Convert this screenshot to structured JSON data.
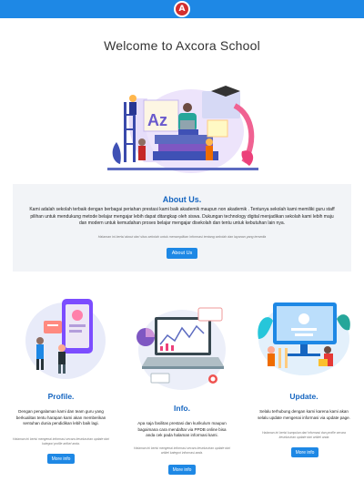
{
  "header": {
    "logo_letter": "A",
    "brand_color": "#1e88e5"
  },
  "hero": {
    "title": "Welcome to Axcora School",
    "illustration_letters": "Az"
  },
  "about": {
    "title": "About Us.",
    "body": "Kami adalah sekolah terbaik dengan berbagai periahan prestasi kami baik akademik maupun non akademik . Tentunya sekolah kami memiliki guru staff pilihan untuk mendukung metode belajar mengajar lebih dapat ditangkap oleh siswa. Dukungan technology digital menjadikan sekolah kami lebih maju dan modern untuk kemudahan proses belajar mengajar disekolah dan tentu untuk kebutuhan lain nya.",
    "note": "Halaman ini berisi about dari situs sekolah untuk menampilkan informasi tentang sekolah dan layanan yang tersedia",
    "button": "About Us"
  },
  "cards": [
    {
      "title": "Profile.",
      "body": "Dengan pengalaman kami dan team guru yang berkualitas tentu harapan kami akan memberikan sentuhan dunia pendidikan lebih baik lagi.",
      "note": "Halaman ini berisi mengenai informasi secara keseluruhan update dari kategori profile artikel anda.",
      "button": "More info"
    },
    {
      "title": "Info.",
      "body": "Apa saja fasilitas prestasi dan kurikulum maupun bagaimana cara mendaftar via PPDB online bisa anda cek pada halaman informasi kami.",
      "note": "Halaman ini berisi mengenai informasi secara keseluruhan update dari artikel kategori informasi anda.",
      "button": "More info"
    },
    {
      "title": "Update.",
      "body": "Selalu terhubung dengan kami karena kami akan selalu update mengenai informasi via update page.",
      "note": "Halaman ini berisi kumpulan dari informasi dan profile secara keseluruhan update dari artikel anda",
      "button": "More info"
    }
  ]
}
